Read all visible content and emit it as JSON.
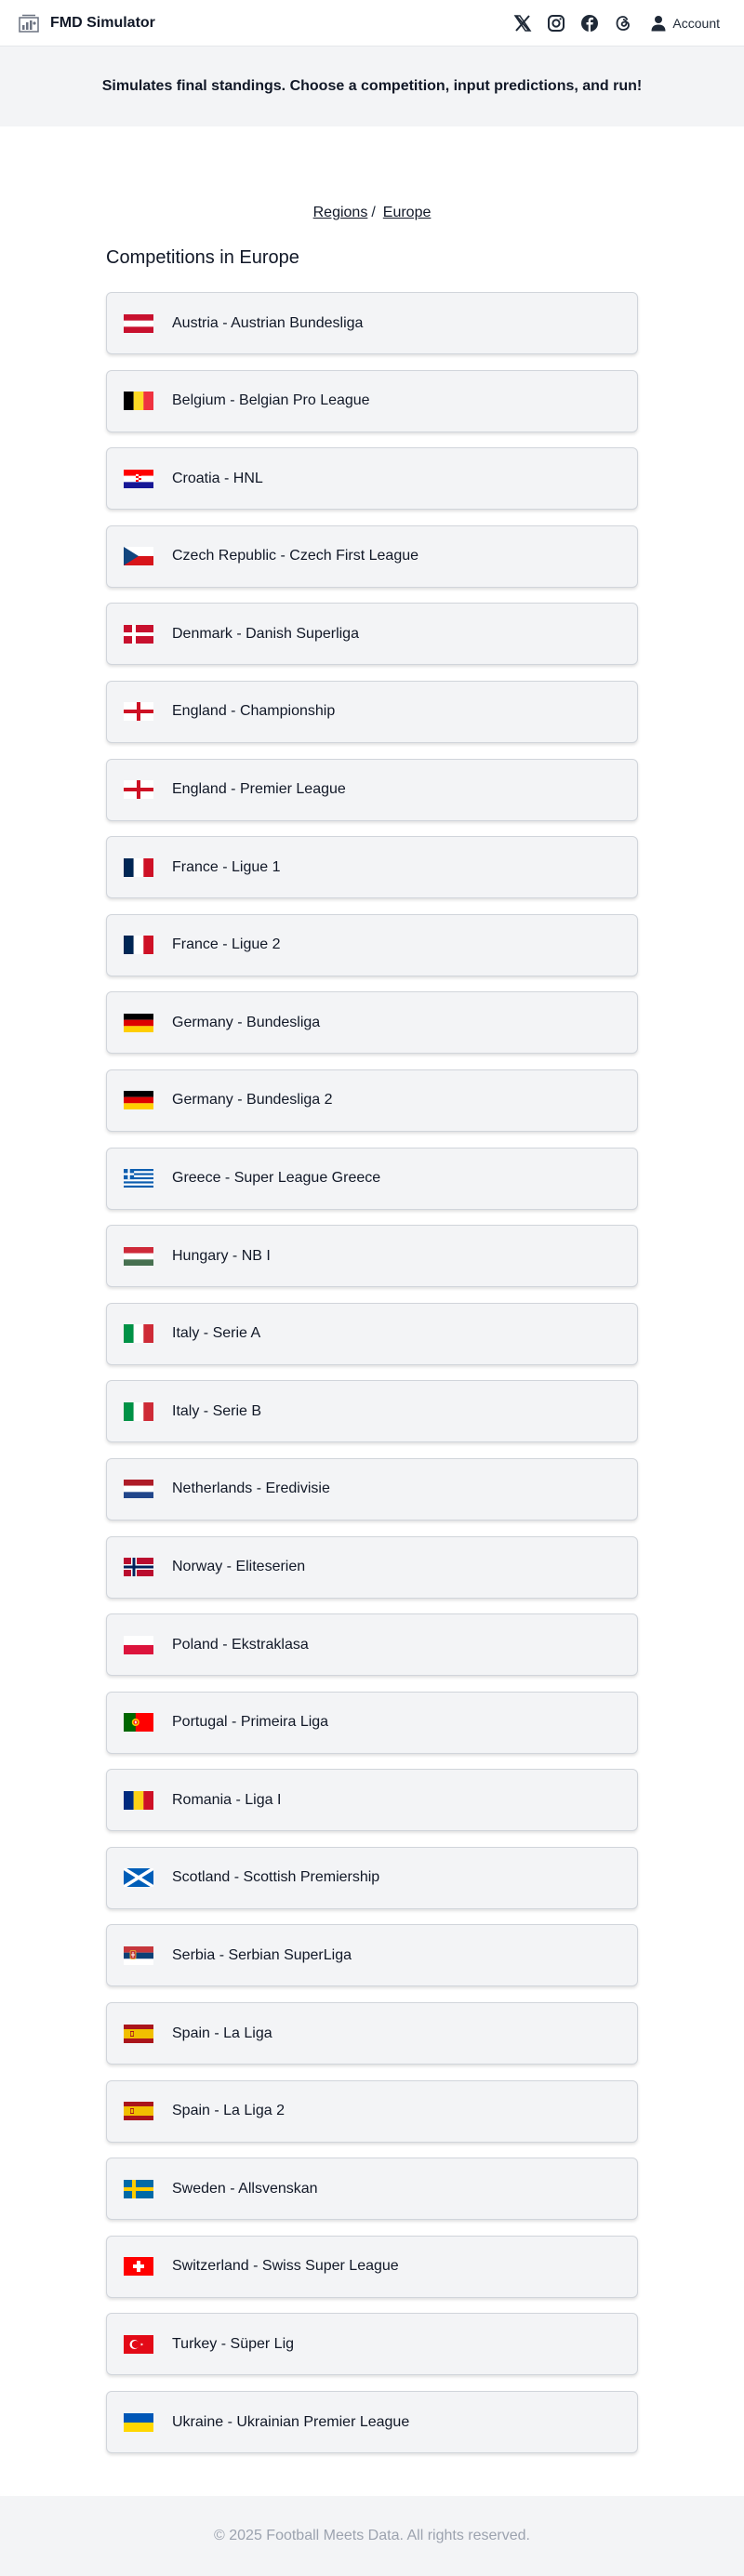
{
  "header": {
    "title": "FMD Simulator",
    "logo_icon": "chart-document-icon",
    "social": [
      "x-twitter-icon",
      "instagram-icon",
      "facebook-icon",
      "threads-icon"
    ],
    "account_label": "Account",
    "account_icon": "user-icon"
  },
  "tagline": "Simulates final standings. Choose a competition, input predictions, and run!",
  "breadcrumb": {
    "items": [
      "Regions",
      "Europe"
    ],
    "separator": "/"
  },
  "section_title": "Competitions in Europe",
  "competitions": [
    {
      "label": "Austria - Austrian Bundesliga",
      "flag": "austria-flag-icon"
    },
    {
      "label": "Belgium - Belgian Pro League",
      "flag": "belgium-flag-icon"
    },
    {
      "label": "Croatia - HNL",
      "flag": "croatia-flag-icon"
    },
    {
      "label": "Czech Republic - Czech First League",
      "flag": "czech-flag-icon"
    },
    {
      "label": "Denmark - Danish Superliga",
      "flag": "denmark-flag-icon"
    },
    {
      "label": "England - Championship",
      "flag": "england-flag-icon"
    },
    {
      "label": "England - Premier League",
      "flag": "england-flag-icon"
    },
    {
      "label": "France - Ligue 1",
      "flag": "france-flag-icon"
    },
    {
      "label": "France - Ligue 2",
      "flag": "france-flag-icon"
    },
    {
      "label": "Germany - Bundesliga",
      "flag": "germany-flag-icon"
    },
    {
      "label": "Germany - Bundesliga 2",
      "flag": "germany-flag-icon"
    },
    {
      "label": "Greece - Super League Greece",
      "flag": "greece-flag-icon"
    },
    {
      "label": "Hungary - NB I",
      "flag": "hungary-flag-icon"
    },
    {
      "label": "Italy - Serie A",
      "flag": "italy-flag-icon"
    },
    {
      "label": "Italy - Serie B",
      "flag": "italy-flag-icon"
    },
    {
      "label": "Netherlands - Eredivisie",
      "flag": "netherlands-flag-icon"
    },
    {
      "label": "Norway - Eliteserien",
      "flag": "norway-flag-icon"
    },
    {
      "label": "Poland - Ekstraklasa",
      "flag": "poland-flag-icon"
    },
    {
      "label": "Portugal - Primeira Liga",
      "flag": "portugal-flag-icon"
    },
    {
      "label": "Romania - Liga I",
      "flag": "romania-flag-icon"
    },
    {
      "label": "Scotland - Scottish Premiership",
      "flag": "scotland-flag-icon"
    },
    {
      "label": "Serbia - Serbian SuperLiga",
      "flag": "serbia-flag-icon"
    },
    {
      "label": "Spain - La Liga",
      "flag": "spain-flag-icon"
    },
    {
      "label": "Spain - La Liga 2",
      "flag": "spain-flag-icon"
    },
    {
      "label": "Sweden - Allsvenskan",
      "flag": "sweden-flag-icon"
    },
    {
      "label": "Switzerland - Swiss Super League",
      "flag": "switzerland-flag-icon"
    },
    {
      "label": "Turkey - Süper Lig",
      "flag": "turkey-flag-icon"
    },
    {
      "label": "Ukraine - Ukrainian Premier League",
      "flag": "ukraine-flag-icon"
    }
  ],
  "footer": "© 2025 Football Meets Data. All rights reserved."
}
